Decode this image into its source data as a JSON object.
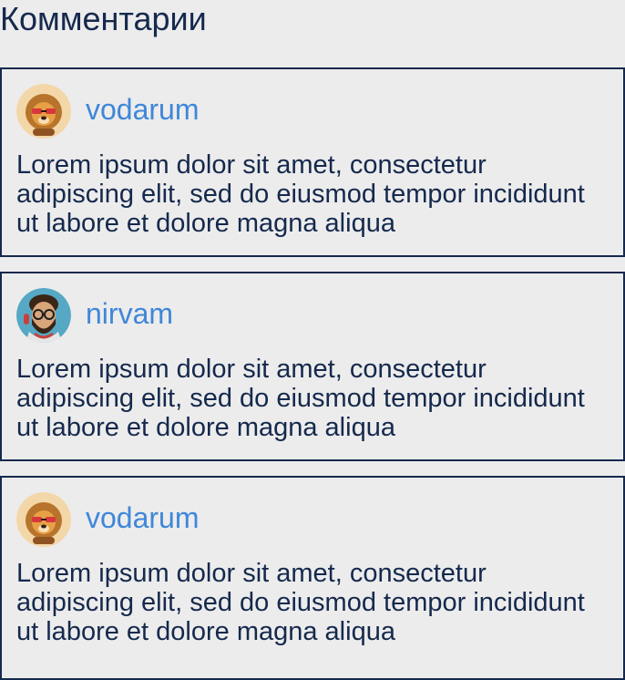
{
  "page": {
    "title": "Комментарии"
  },
  "colors": {
    "background": "#ececec",
    "text": "#15294d",
    "username": "#3f87d9",
    "border": "#15294d"
  },
  "comments": [
    {
      "username": "vodarum",
      "avatar_icon": "lion-avatar-icon",
      "text": "Lorem ipsum dolor sit amet, consectetur adipiscing elit, sed do eiusmod tempor incididunt ut labore et dolore magna aliqua"
    },
    {
      "username": "nirvam",
      "avatar_icon": "bearded-man-avatar-icon",
      "text": "Lorem ipsum dolor sit amet, consectetur adipiscing elit, sed do eiusmod tempor incididunt ut labore et dolore magna aliqua"
    },
    {
      "username": "vodarum",
      "avatar_icon": "lion-avatar-icon",
      "text": "Lorem ipsum dolor sit amet, consectetur adipiscing elit, sed do eiusmod tempor incididunt ut labore et dolore magna aliqua"
    }
  ]
}
